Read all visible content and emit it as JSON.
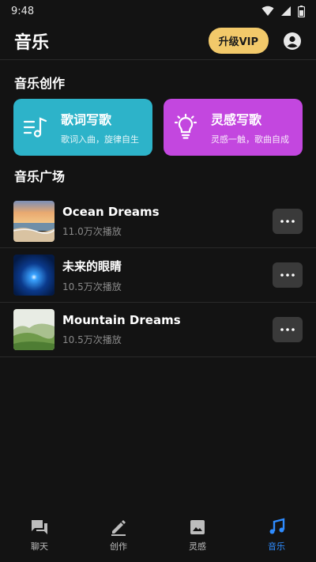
{
  "status_bar": {
    "time": "9:48"
  },
  "header": {
    "title": "音乐",
    "vip_label": "升级VIP"
  },
  "creation": {
    "section_title": "音乐创作",
    "cards": [
      {
        "title": "歌词写歌",
        "subtitle": "歌词入曲，旋律自生",
        "color": "#2db3c9",
        "icon": "lyrics-note-icon"
      },
      {
        "title": "灵感写歌",
        "subtitle": "灵感一触，歌曲自成",
        "color": "#c347df",
        "icon": "lightbulb-icon"
      }
    ]
  },
  "plaza": {
    "section_title": "音乐广场",
    "songs": [
      {
        "title": "Ocean Dreams",
        "plays": "11.0万次播放",
        "thumb": "ocean-sunset"
      },
      {
        "title": "未来的眼睛",
        "plays": "10.5万次播放",
        "thumb": "blue-light"
      },
      {
        "title": "Mountain Dreams",
        "plays": "10.5万次播放",
        "thumb": "green-mountain"
      }
    ]
  },
  "bottom_nav": {
    "active_color": "#2f8cff",
    "items": [
      {
        "label": "聊天",
        "icon": "chat-icon",
        "active": false
      },
      {
        "label": "创作",
        "icon": "pencil-icon",
        "active": false
      },
      {
        "label": "灵感",
        "icon": "image-icon",
        "active": false
      },
      {
        "label": "音乐",
        "icon": "music-note-icon",
        "active": true
      }
    ]
  }
}
